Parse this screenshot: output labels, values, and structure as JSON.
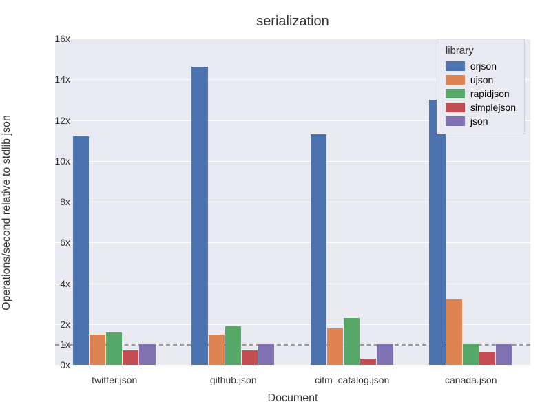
{
  "chart_data": {
    "type": "bar",
    "title": "serialization",
    "xlabel": "Document",
    "ylabel": "Operations/second relative to stdlib json",
    "ylim": [
      0,
      16
    ],
    "yticks": [
      0,
      1,
      2,
      4,
      6,
      8,
      10,
      12,
      14,
      16
    ],
    "ytick_labels": [
      "0x",
      "1x",
      "2x",
      "4x",
      "6x",
      "8x",
      "10x",
      "12x",
      "14x",
      "16x"
    ],
    "categories": [
      "twitter.json",
      "github.json",
      "citm_catalog.json",
      "canada.json"
    ],
    "baseline": 1,
    "legend_title": "library",
    "series": [
      {
        "name": "orjson",
        "color": "#4c72b0",
        "values": [
          11.2,
          14.6,
          11.3,
          13.0
        ]
      },
      {
        "name": "ujson",
        "color": "#dd8452",
        "values": [
          1.5,
          1.5,
          1.8,
          3.2
        ]
      },
      {
        "name": "rapidjson",
        "color": "#55a868",
        "values": [
          1.6,
          1.9,
          2.3,
          1.0
        ]
      },
      {
        "name": "simplejson",
        "color": "#c44e52",
        "values": [
          0.7,
          0.7,
          0.3,
          0.6
        ]
      },
      {
        "name": "json",
        "color": "#8172b3",
        "values": [
          1.0,
          1.0,
          1.0,
          1.0
        ]
      }
    ]
  }
}
